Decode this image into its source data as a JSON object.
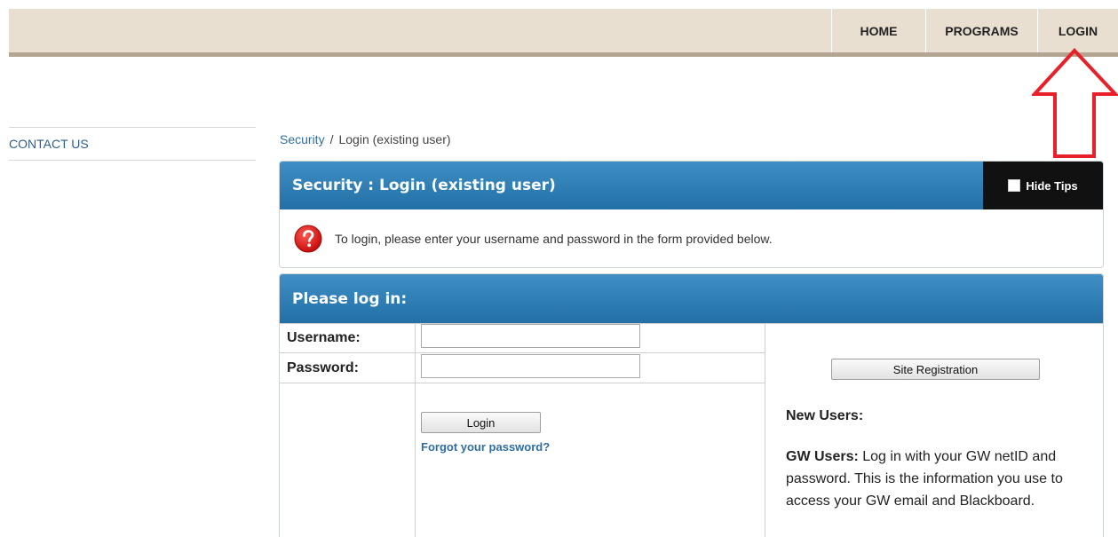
{
  "topnav": {
    "home": "HOME",
    "programs": "PROGRAMS",
    "login": "LOGIN"
  },
  "sidebar": {
    "items": [
      {
        "label": "CONTACT US"
      }
    ]
  },
  "breadcrumb": {
    "root": "Security",
    "separator": "/",
    "current": "Login (existing user)"
  },
  "security_panel": {
    "title": "Security : Login (existing user)",
    "hide_tips_label": "Hide Tips",
    "tip_text": "To login, please enter your username and password in the form provided below."
  },
  "login_panel": {
    "title": "Please log in:",
    "username_label": "Username:",
    "username_value": "",
    "password_label": "Password:",
    "password_value": "",
    "login_button": "Login",
    "forgot_password": "Forgot your password?",
    "site_registration_button": "Site Registration",
    "new_users_heading": "New Users:",
    "gw_users_label": "GW Users:",
    "gw_users_text": " Log in with your GW netID and password. This is the information you use to access your GW email and Blackboard."
  },
  "colors": {
    "topbar_bg": "#e9dfd0",
    "panel_header": "#2270a6",
    "link": "#2e6ea3",
    "arrow": "#e8202a"
  }
}
